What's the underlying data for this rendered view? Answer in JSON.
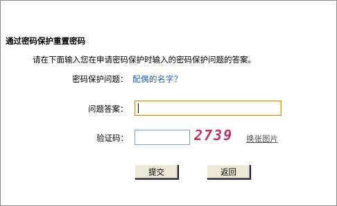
{
  "form": {
    "heading": "通过密码保护重置密码",
    "instruction": "请在下面输入您在申请密码保护时输入的密码保护问题的答案。",
    "question_label": "密码保护问题：",
    "question_value": "配偶的名字？",
    "answer_label": "问题答案：",
    "answer_value": "",
    "verify_label": "验证码：",
    "verify_value": "",
    "captcha_text": "2739",
    "change_image_label": "换张图片",
    "submit_label": "提交",
    "back_label": "返回"
  },
  "colors": {
    "question_text": "#1a5aa6",
    "captcha_text": "#c0306a",
    "focused_input_border": "#c69a3a",
    "button_face": "#ece9d8"
  }
}
